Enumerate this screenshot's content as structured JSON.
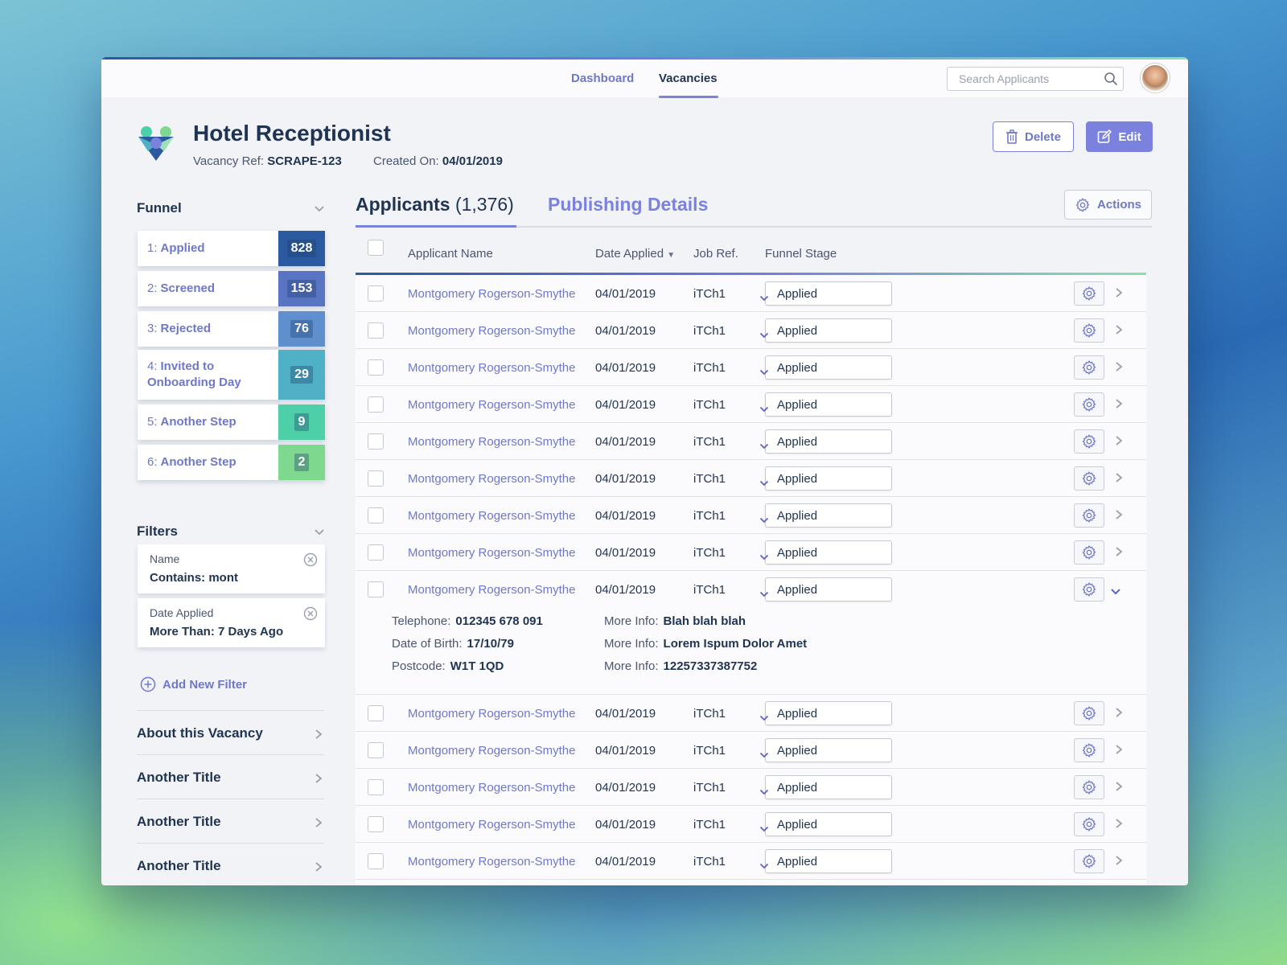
{
  "nav": {
    "dashboard": "Dashboard",
    "vacancies": "Vacancies",
    "search_placeholder": "Search Applicants"
  },
  "vacancy": {
    "title": "Hotel Receptionist",
    "ref_label": "Vacancy Ref:",
    "ref": "SCRAPE-123",
    "created_label": "Created On:",
    "created": "04/01/2019"
  },
  "buttons": {
    "delete": "Delete",
    "edit": "Edit",
    "actions": "Actions"
  },
  "funnel": {
    "heading": "Funnel",
    "items": [
      {
        "num": "1:",
        "label": "Applied",
        "count": "828",
        "color": "#2b5aa0"
      },
      {
        "num": "2:",
        "label": "Screened",
        "count": "153",
        "color": "#5a74c4"
      },
      {
        "num": "3:",
        "label": "Rejected",
        "count": "76",
        "color": "#5f8fcc"
      },
      {
        "num": "4:",
        "label": "Invited to Onboarding Day",
        "count": "29",
        "color": "#4fb0c6"
      },
      {
        "num": "5:",
        "label": "Another Step",
        "count": "9",
        "color": "#4dd0a8"
      },
      {
        "num": "6:",
        "label": "Another Step",
        "count": "2",
        "color": "#7ed88e"
      }
    ]
  },
  "filters": {
    "heading": "Filters",
    "items": [
      {
        "label": "Name",
        "value": "Contains: mont"
      },
      {
        "label": "Date Applied",
        "value": "More Than: 7 Days Ago"
      }
    ],
    "add": "Add New Filter"
  },
  "sections": [
    "About this Vacancy",
    "Another Title",
    "Another Title",
    "Another Title"
  ],
  "tabs": {
    "applicants": "Applicants",
    "applicants_count": "(1,376)",
    "publishing": "Publishing Details"
  },
  "columns": {
    "name": "Applicant Name",
    "date": "Date Applied",
    "ref": "Job Ref.",
    "stage": "Funnel Stage"
  },
  "rows": [
    {
      "name": "Montgomery Rogerson-Smythe",
      "date": "04/01/2019",
      "ref": "iTCh1",
      "stage": "Applied"
    },
    {
      "name": "Montgomery Rogerson-Smythe",
      "date": "04/01/2019",
      "ref": "iTCh1",
      "stage": "Applied"
    },
    {
      "name": "Montgomery Rogerson-Smythe",
      "date": "04/01/2019",
      "ref": "iTCh1",
      "stage": "Applied"
    },
    {
      "name": "Montgomery Rogerson-Smythe",
      "date": "04/01/2019",
      "ref": "iTCh1",
      "stage": "Applied"
    },
    {
      "name": "Montgomery Rogerson-Smythe",
      "date": "04/01/2019",
      "ref": "iTCh1",
      "stage": "Applied"
    },
    {
      "name": "Montgomery Rogerson-Smythe",
      "date": "04/01/2019",
      "ref": "iTCh1",
      "stage": "Applied"
    },
    {
      "name": "Montgomery Rogerson-Smythe",
      "date": "04/01/2019",
      "ref": "iTCh1",
      "stage": "Applied"
    },
    {
      "name": "Montgomery Rogerson-Smythe",
      "date": "04/01/2019",
      "ref": "iTCh1",
      "stage": "Applied"
    },
    {
      "name": "Montgomery Rogerson-Smythe",
      "date": "04/01/2019",
      "ref": "iTCh1",
      "stage": "Applied",
      "expanded": true
    },
    {
      "name": "Montgomery Rogerson-Smythe",
      "date": "04/01/2019",
      "ref": "iTCh1",
      "stage": "Applied"
    },
    {
      "name": "Montgomery Rogerson-Smythe",
      "date": "04/01/2019",
      "ref": "iTCh1",
      "stage": "Applied"
    },
    {
      "name": "Montgomery Rogerson-Smythe",
      "date": "04/01/2019",
      "ref": "iTCh1",
      "stage": "Applied"
    },
    {
      "name": "Montgomery Rogerson-Smythe",
      "date": "04/01/2019",
      "ref": "iTCh1",
      "stage": "Applied"
    },
    {
      "name": "Montgomery Rogerson-Smythe",
      "date": "04/01/2019",
      "ref": "iTCh1",
      "stage": "Applied"
    }
  ],
  "details": {
    "telephone_label": "Telephone:",
    "telephone": "012345 678 091",
    "dob_label": "Date of Birth:",
    "dob": "17/10/79",
    "postcode_label": "Postcode:",
    "postcode": "W1T 1QD",
    "more": [
      {
        "label": "More Info:",
        "value": "Blah blah blah"
      },
      {
        "label": "More Info:",
        "value": "Lorem Ispum Dolor Amet"
      },
      {
        "label": "More Info:",
        "value": "12257337387752"
      }
    ]
  },
  "colors": {
    "accent": "#7b82dd",
    "navy": "#1f3352"
  }
}
